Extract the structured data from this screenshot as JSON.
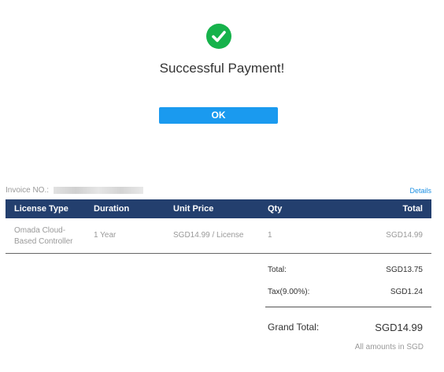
{
  "status": {
    "icon": "check-circle-icon",
    "title": "Successful Payment!",
    "ok_label": "OK"
  },
  "invoice": {
    "label": "Invoice NO.:",
    "details_label": "Details"
  },
  "table": {
    "headers": [
      "License Type",
      "Duration",
      "Unit Price",
      "Qty",
      "Total"
    ],
    "rows": [
      {
        "license_type": "Omada Cloud-Based Controller",
        "duration": "1 Year",
        "unit_price": "SGD14.99 / License",
        "qty": "1",
        "total": "SGD14.99"
      }
    ]
  },
  "summary": {
    "total_label": "Total:",
    "total_value": "SGD13.75",
    "tax_label": "Tax(9.00%):",
    "tax_value": "SGD1.24",
    "grand_total_label": "Grand Total:",
    "grand_total_value": "SGD14.99",
    "currency_note": "All amounts in SGD"
  },
  "colors": {
    "success": "#16b24b",
    "primary_button": "#1a9aef",
    "table_header": "#233f6e",
    "link": "#1a8fe3"
  }
}
